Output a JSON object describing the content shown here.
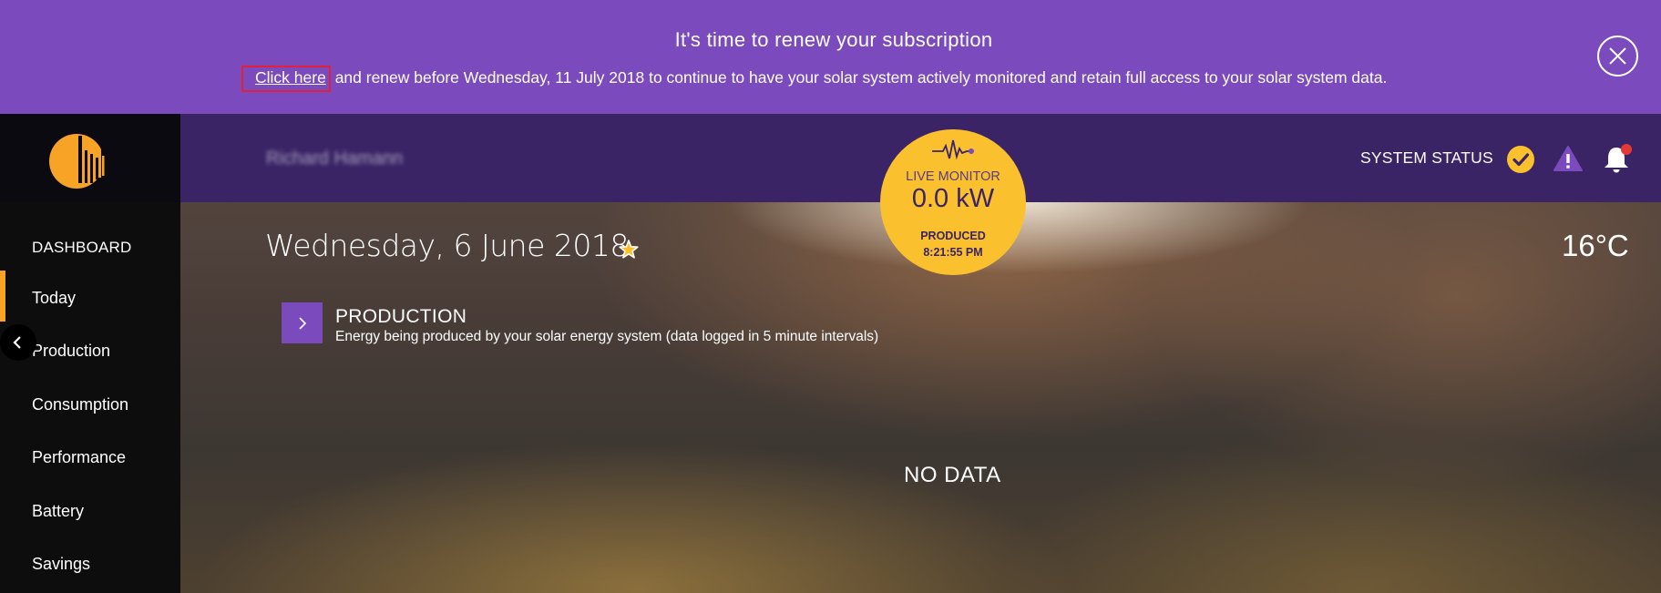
{
  "banner": {
    "title": "It's time to renew your subscription",
    "link_label": "Click here",
    "message": "and renew before Wednesday, 11 July 2018 to continue to have your solar system actively monitored and retain full access to your solar system data."
  },
  "header": {
    "username": "Richard Hamann",
    "system_status_label": "SYSTEM STATUS"
  },
  "live_monitor": {
    "label": "LIVE MONITOR",
    "value": "0.0 kW",
    "produced_label": "PRODUCED",
    "time": "8:21:55 PM"
  },
  "sidebar": {
    "heading": "DASHBOARD",
    "items": [
      {
        "label": "Today"
      },
      {
        "label": "Production"
      },
      {
        "label": "Consumption"
      },
      {
        "label": "Performance"
      },
      {
        "label": "Battery"
      },
      {
        "label": "Savings"
      }
    ]
  },
  "main": {
    "date": "Wednesday, 6 June 2018",
    "temperature": "16°C",
    "section_title": "PRODUCTION",
    "section_desc": "Energy being produced by your solar energy system (data logged in 5 minute intervals)",
    "empty_state": "NO DATA"
  },
  "colors": {
    "banner": "#7b4bbd",
    "topbar": "#3a2466",
    "accent": "#fbc02d",
    "active_nav": "#f7a325"
  }
}
